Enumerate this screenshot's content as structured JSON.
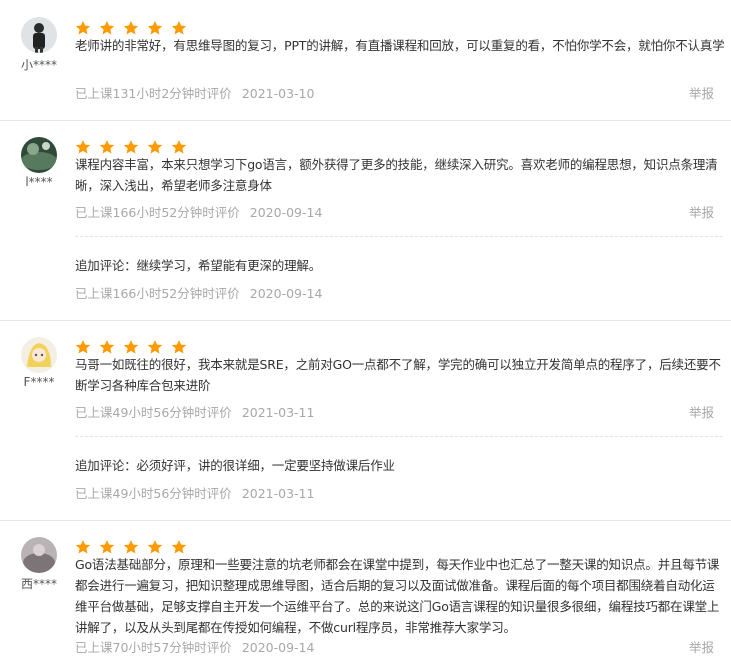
{
  "colors": {
    "star": "#ff9a00",
    "meta": "#a8a8a8",
    "text": "#333333"
  },
  "reviews": [
    {
      "user": "小****",
      "rating": 5,
      "text": "老师讲的非常好，有思维导图的复习，PPT的讲解，有直播课程和回放，可以重复的看，不怕你学不会，就怕你不认真学",
      "study": "已上课131小时2分钟时评价",
      "date": "2021-03-10",
      "report": "举报"
    },
    {
      "user": "l****",
      "rating": 5,
      "text": "课程内容丰富，本来只想学习下go语言，额外获得了更多的技能，继续深入研究。喜欢老师的编程思想，知识点条理清晰，深入浅出，希望老师多注意身体",
      "study": "已上课166小时52分钟时评价",
      "date": "2020-09-14",
      "report": "举报",
      "followup": {
        "text": "追加评论：继续学习，希望能有更深的理解。",
        "study": "已上课166小时52分钟时评价",
        "date": "2020-09-14"
      }
    },
    {
      "user": "F****",
      "rating": 5,
      "text": "马哥一如既往的很好，我本来就是SRE，之前对GO一点都不了解，学完的确可以独立开发简单点的程序了，后续还要不断学习各种库合包来进阶",
      "study": "已上课49小时56分钟时评价",
      "date": "2021-03-11",
      "report": "举报",
      "followup": {
        "text": "追加评论：必须好评，讲的很详细，一定要坚持做课后作业",
        "study": "已上课49小时56分钟时评价",
        "date": "2021-03-11"
      }
    },
    {
      "user": "西****",
      "rating": 5,
      "text": "Go语法基础部分，原理和一些要注意的坑老师都会在课堂中提到，每天作业中也汇总了一整天课的知识点。并且每节课都会进行一遍复习，把知识整理成思维导图，适合后期的复习以及面试做准备。课程后面的每个项目都围绕着自动化运维平台做基础，足够支撑自主开发一个运维平台了。总的来说这门Go语言课程的知识量很多很细，编程技巧都在课堂上讲解了，以及从头到尾都在传授如何编程，不做curl程序员，非常推荐大家学习。",
      "study": "已上课70小时57分钟时评价",
      "date": "2020-09-14",
      "report": "举报"
    }
  ]
}
